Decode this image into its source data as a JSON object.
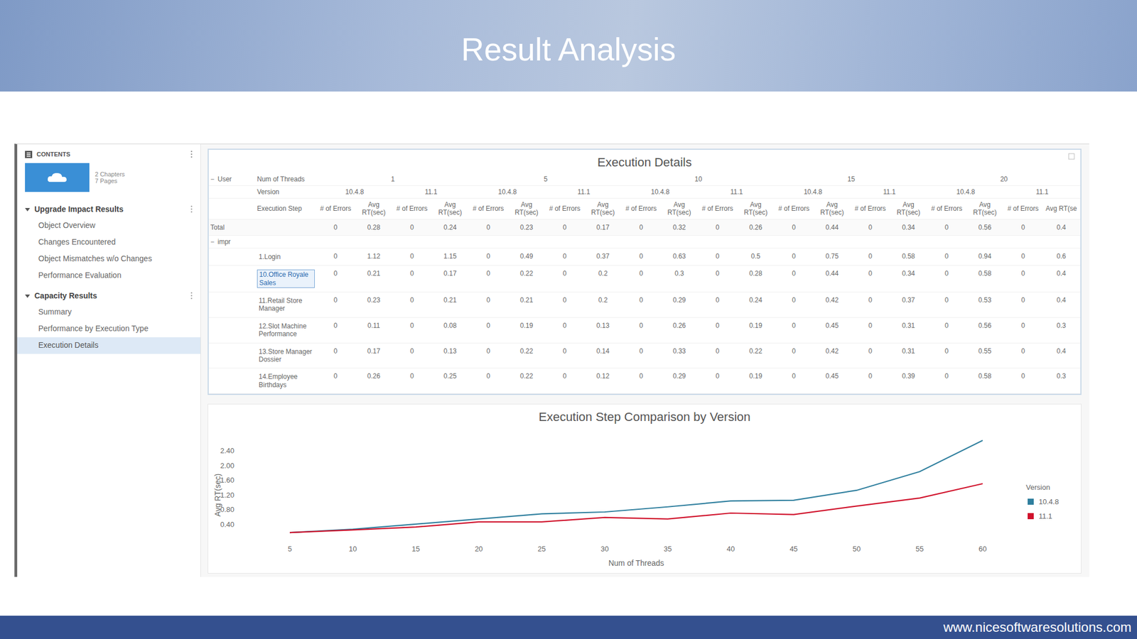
{
  "slide": {
    "title": "Result Analysis",
    "footer_url": "www.nicesoftwaresolutions.com"
  },
  "sidebar": {
    "header": "CONTENTS",
    "thumbnail_meta": [
      "2 Chapters",
      "7 Pages"
    ],
    "sections": [
      {
        "title": "Upgrade Impact Results",
        "expanded": true,
        "items": [
          {
            "label": "Object Overview",
            "selected": false
          },
          {
            "label": "Changes Encountered",
            "selected": false
          },
          {
            "label": "Object Mismatches w/o Changes",
            "selected": false
          },
          {
            "label": "Performance Evaluation",
            "selected": false
          }
        ]
      },
      {
        "title": "Capacity Results",
        "expanded": true,
        "items": [
          {
            "label": "Summary",
            "selected": false
          },
          {
            "label": "Performance by Execution Type",
            "selected": false
          },
          {
            "label": "Execution Details",
            "selected": true
          }
        ]
      }
    ]
  },
  "table": {
    "title": "Execution Details",
    "collapse_icon": "−",
    "user_label": "User",
    "threads_label": "Num of Threads",
    "version_label": "Version",
    "step_label": "Execution Step",
    "thread_groups": [
      {
        "threads": "1",
        "versions": [
          "10.4.8",
          "11.1"
        ]
      },
      {
        "threads": "5",
        "versions": [
          "10.4.8",
          "11.1"
        ]
      },
      {
        "threads": "10",
        "versions": [
          "10.4.8",
          "11.1"
        ]
      },
      {
        "threads": "15",
        "versions": [
          "10.4.8",
          "11.1"
        ]
      },
      {
        "threads": "20",
        "versions": [
          "10.4.8",
          "11.1"
        ]
      }
    ],
    "metric_headers": [
      "# of Errors",
      "Avg RT(sec)",
      "# of Errors",
      "Avg RT(sec)",
      "# of Errors",
      "Avg RT(sec)",
      "# of Errors",
      "Avg RT(sec)",
      "# of Errors",
      "Avg RT(sec)",
      "# of Errors",
      "Avg RT(sec)",
      "# of Errors",
      "Avg RT(sec)",
      "# of Errors",
      "Avg RT(sec)",
      "# of Errors",
      "Avg RT(sec)",
      "# of Errors",
      "Avg RT(se"
    ],
    "rows": [
      {
        "kind": "total",
        "label": "Total",
        "selected": false,
        "cells": [
          "0",
          "0.28",
          "0",
          "0.24",
          "0",
          "0.23",
          "0",
          "0.17",
          "0",
          "0.32",
          "0",
          "0.26",
          "0",
          "0.44",
          "0",
          "0.34",
          "0",
          "0.56",
          "0",
          "0.4"
        ]
      },
      {
        "kind": "group",
        "label": "impr",
        "icon": "−",
        "selected": false,
        "cells": []
      },
      {
        "kind": "step",
        "label": "1.Login",
        "selected": false,
        "cells": [
          "0",
          "1.12",
          "0",
          "1.15",
          "0",
          "0.49",
          "0",
          "0.37",
          "0",
          "0.63",
          "0",
          "0.5",
          "0",
          "0.75",
          "0",
          "0.58",
          "0",
          "0.94",
          "0",
          "0.6"
        ]
      },
      {
        "kind": "step",
        "label": "10.Office Royale Sales",
        "selected": true,
        "cells": [
          "0",
          "0.21",
          "0",
          "0.17",
          "0",
          "0.22",
          "0",
          "0.2",
          "0",
          "0.3",
          "0",
          "0.28",
          "0",
          "0.44",
          "0",
          "0.34",
          "0",
          "0.58",
          "0",
          "0.4"
        ]
      },
      {
        "kind": "step",
        "label": "11.Retail Store Manager",
        "selected": false,
        "cells": [
          "0",
          "0.23",
          "0",
          "0.21",
          "0",
          "0.21",
          "0",
          "0.2",
          "0",
          "0.29",
          "0",
          "0.24",
          "0",
          "0.42",
          "0",
          "0.37",
          "0",
          "0.53",
          "0",
          "0.4"
        ]
      },
      {
        "kind": "step",
        "label": "12.Slot Machine Performance",
        "selected": false,
        "cells": [
          "0",
          "0.11",
          "0",
          "0.08",
          "0",
          "0.19",
          "0",
          "0.13",
          "0",
          "0.26",
          "0",
          "0.19",
          "0",
          "0.45",
          "0",
          "0.31",
          "0",
          "0.56",
          "0",
          "0.3"
        ]
      },
      {
        "kind": "step",
        "label": "13.Store Manager Dossier",
        "selected": false,
        "cells": [
          "0",
          "0.17",
          "0",
          "0.13",
          "0",
          "0.22",
          "0",
          "0.14",
          "0",
          "0.33",
          "0",
          "0.22",
          "0",
          "0.42",
          "0",
          "0.31",
          "0",
          "0.55",
          "0",
          "0.4"
        ]
      },
      {
        "kind": "step",
        "label": "14.Employee Birthdays",
        "selected": false,
        "cells": [
          "0",
          "0.26",
          "0",
          "0.25",
          "0",
          "0.22",
          "0",
          "0.12",
          "0",
          "0.29",
          "0",
          "0.19",
          "0",
          "0.45",
          "0",
          "0.39",
          "0",
          "0.58",
          "0",
          "0.3"
        ]
      }
    ]
  },
  "chart": {
    "title": "Execution Step Comparison by Version",
    "y_label": "Avg RT(sec)",
    "x_label": "Num of Threads",
    "y_ticks": [
      "0.40",
      "0.80",
      "1.20",
      "1.60",
      "2.00",
      "2.40"
    ],
    "x_ticks": [
      "5",
      "10",
      "15",
      "20",
      "25",
      "30",
      "35",
      "40",
      "45",
      "50",
      "55",
      "60"
    ],
    "legend_title": "Version",
    "series": [
      {
        "name": "10.4.8",
        "color": "#2f7f9e",
        "values": [
          0.18,
          0.27,
          0.41,
          0.55,
          0.69,
          0.74,
          0.88,
          1.04,
          1.06,
          1.33,
          1.84,
          2.69
        ]
      },
      {
        "name": "11.1",
        "color": "#d0112b",
        "values": [
          0.18,
          0.25,
          0.33,
          0.47,
          0.47,
          0.59,
          0.55,
          0.71,
          0.67,
          0.9,
          1.12,
          1.51
        ]
      }
    ]
  }
}
